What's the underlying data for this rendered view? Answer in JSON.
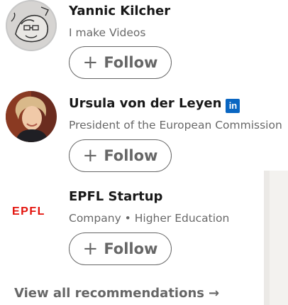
{
  "recommendations": [
    {
      "name": "Yannic Kilcher",
      "headline": "I make Videos",
      "follow_label": "Follow",
      "avatar_icon": "sketch-avatar"
    },
    {
      "name": "Ursula von der Leyen",
      "headline": "President of the European Commission",
      "follow_label": "Follow",
      "badge": "in",
      "avatar_icon": "photo-avatar"
    },
    {
      "name": "EPFL Startup",
      "headline": "Company • Higher Education",
      "follow_label": "Follow",
      "logo_text": "EPFL"
    }
  ],
  "footer": {
    "view_all_label": "View all recommendations",
    "arrow_icon": "arrow-right-icon"
  },
  "colors": {
    "linkedin_blue": "#0a66c2",
    "epfl_red": "#e3120b",
    "text_secondary": "rgba(0,0,0,0.6)"
  }
}
